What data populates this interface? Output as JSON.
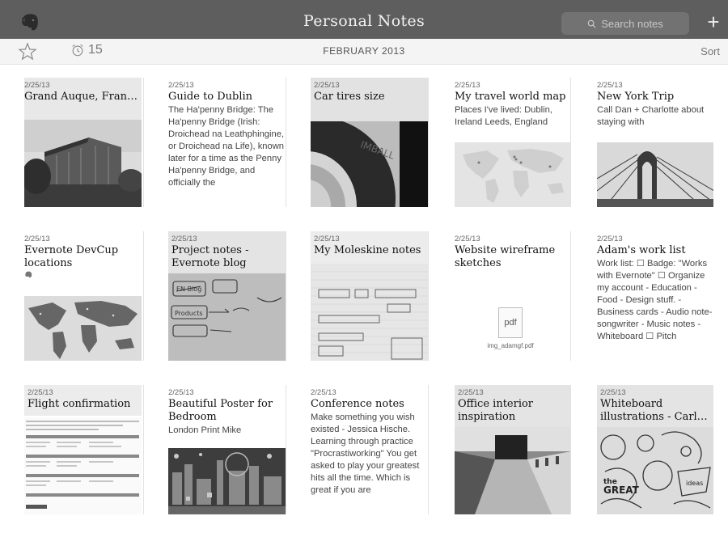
{
  "app": {
    "title": "Personal Notes"
  },
  "search": {
    "placeholder": "Search notes"
  },
  "subbar": {
    "reminder_count": "15",
    "month": "FEBRUARY 2013",
    "sort_label": "Sort"
  },
  "notes": [
    {
      "date": "2/25/13",
      "title": "Grand Auque, Fran…",
      "body": ""
    },
    {
      "date": "2/25/13",
      "title": "Guide to Dublin",
      "body": "The Ha'penny Bridge: The Ha'penny Bridge (Irish: Droichead na Leathphingine, or Droichead na Life), known later for a time as the Penny Ha'penny Bridge, and officially the"
    },
    {
      "date": "2/25/13",
      "title": "Car tires size",
      "body": ""
    },
    {
      "date": "2/25/13",
      "title": "My travel world map",
      "body": "Places I've lived: Dublin, Ireland Leeds, England"
    },
    {
      "date": "2/25/13",
      "title": "New York Trip",
      "body": "Call Dan + Charlotte about staying with"
    },
    {
      "date": "2/25/13",
      "title": "Evernote DevCup locations",
      "body": ""
    },
    {
      "date": "2/25/13",
      "title": "Project notes - Evernote blog",
      "body": ""
    },
    {
      "date": "2/25/13",
      "title": "My Moleskine notes",
      "body": ""
    },
    {
      "date": "2/25/13",
      "title": "Website wireframe sketches",
      "body": "",
      "attachment": {
        "type": "pdf",
        "filename": "img_adamgf.pdf"
      }
    },
    {
      "date": "2/25/13",
      "title": "Adam's work list",
      "body": "Work list: ☐ Badge: \"Works with Evernote\" ☐ Organize my account - Education - Food - Design stuff. - Business cards - Audio note-songwriter - Music notes - Whiteboard ☐ Pitch"
    },
    {
      "date": "2/25/13",
      "title": "Flight confirmation",
      "body": ""
    },
    {
      "date": "2/25/13",
      "title": "Beautiful  Poster for Bedroom",
      "body": "London Print Mike"
    },
    {
      "date": "2/25/13",
      "title": "Conference notes",
      "body": "Make something you wish existed - Jessica Hische. Learning through practice \"Procrastiworking\" You get asked to play your greatest hits all the time. Which is great if you are"
    },
    {
      "date": "2/25/13",
      "title": "Office interior inspiration",
      "body": ""
    },
    {
      "date": "2/25/13",
      "title": "Whiteboard illustrations - Carl…",
      "body": ""
    }
  ],
  "colors": {
    "topbar": "#5e5e5e",
    "subbar": "#f4f4f4",
    "title_text": "#f2f2f2"
  },
  "icons": [
    "evernote-elephant-icon",
    "search-icon",
    "plus-icon",
    "star-icon",
    "alarm-clock-icon",
    "pdf-file-icon"
  ]
}
